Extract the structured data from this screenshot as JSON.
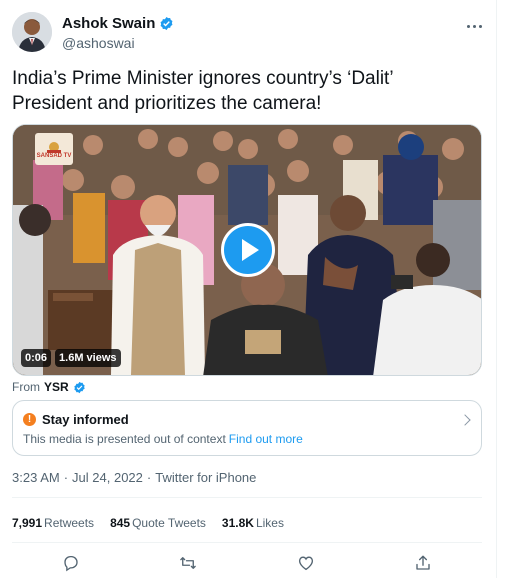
{
  "author": {
    "display_name": "Ashok Swain",
    "handle": "@ashoswai",
    "verified": true
  },
  "tweet": {
    "text": "India’s Prime Minister ignores country’s ‘Dalit’ President and prioritizes the camera!"
  },
  "media": {
    "duration": "0:06",
    "views": "1.6M views",
    "channel_logo_text": "SANSAD TV",
    "play_button_color": "#1d9bf0"
  },
  "attribution": {
    "prefix": "From",
    "user": "YSR",
    "verified": true
  },
  "notice": {
    "title": "Stay informed",
    "body": "This media is presented out of context",
    "link": "Find out more",
    "icon_color": "#f47f1f"
  },
  "meta": {
    "time": "3:23 AM",
    "separator1": "·",
    "date": "Jul 24, 2022",
    "separator2": "·",
    "source": "Twitter for iPhone"
  },
  "stats": {
    "retweets_count": "7,991",
    "retweets_label": "Retweets",
    "quotes_count": "845",
    "quotes_label": "Quote Tweets",
    "likes_count": "31.8K",
    "likes_label": "Likes"
  },
  "icons": [
    "verified-badge-icon",
    "more-options-icon",
    "play-icon",
    "warning-icon",
    "chevron-right-icon",
    "reply-icon",
    "retweet-icon",
    "like-icon",
    "share-icon"
  ],
  "colors": {
    "accent": "#1d9bf0",
    "text_primary": "#0f1419",
    "text_secondary": "#536471",
    "border": "#cfd9de"
  }
}
